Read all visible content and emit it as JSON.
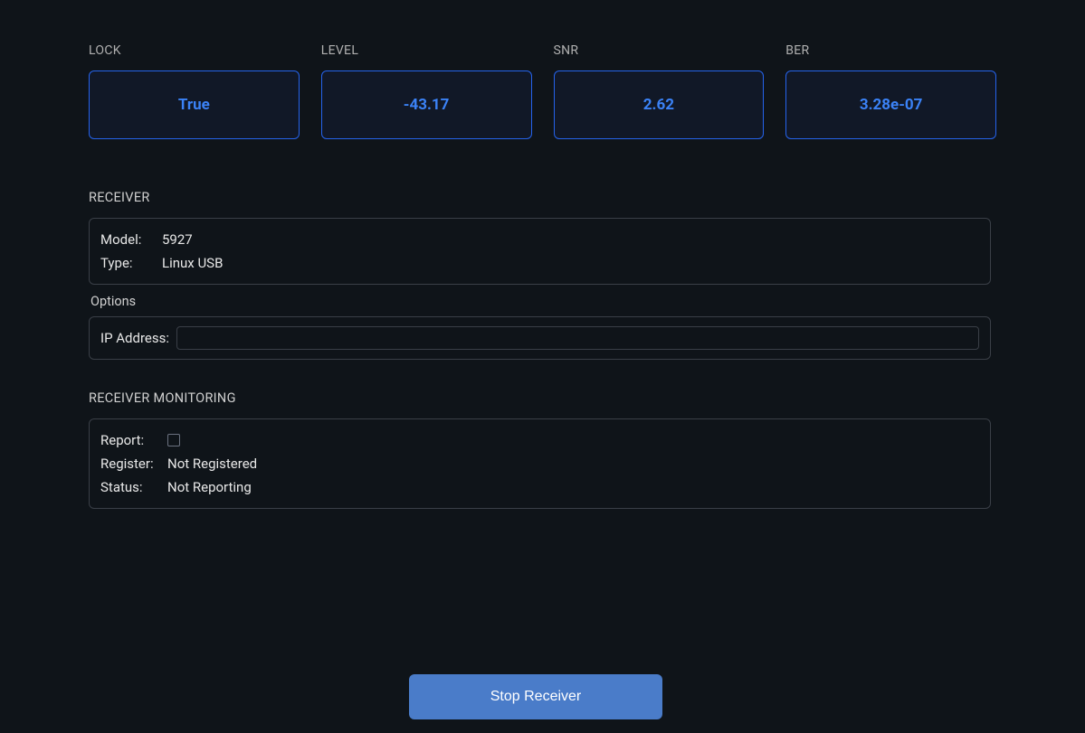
{
  "stats": {
    "lock": {
      "label": "LOCK",
      "value": "True"
    },
    "level": {
      "label": "LEVEL",
      "value": "-43.17"
    },
    "snr": {
      "label": "SNR",
      "value": "2.62"
    },
    "ber": {
      "label": "BER",
      "value": "3.28e-07"
    }
  },
  "receiver": {
    "section_label": "RECEIVER",
    "model_label": "Model:",
    "model_value": "5927",
    "type_label": "Type:",
    "type_value": "Linux USB",
    "options_label": "Options",
    "ip_label": "IP Address:",
    "ip_value": ""
  },
  "monitoring": {
    "section_label": "RECEIVER MONITORING",
    "report_label": "Report:",
    "report_checked": false,
    "register_label": "Register:",
    "register_value": "Not Registered",
    "status_label": "Status:",
    "status_value": "Not Reporting"
  },
  "actions": {
    "stop_label": "Stop Receiver"
  }
}
